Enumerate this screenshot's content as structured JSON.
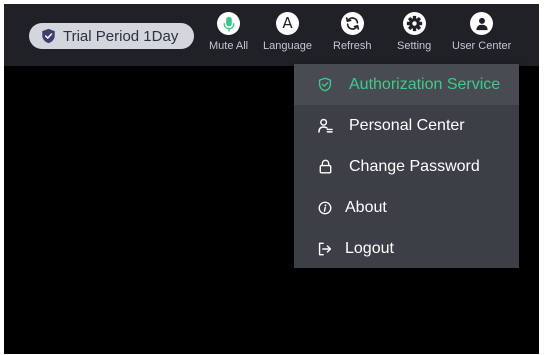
{
  "header": {
    "trial_badge": "Trial Period 1Day",
    "buttons": {
      "mute_all": {
        "label": "Mute All",
        "icon": "microphone-icon"
      },
      "language": {
        "label": "Language",
        "glyph": "A",
        "icon": "language-icon"
      },
      "refresh": {
        "label": "Refresh",
        "icon": "refresh-icon"
      },
      "setting": {
        "label": "Setting",
        "icon": "gear-icon"
      },
      "user_center": {
        "label": "User Center",
        "icon": "user-icon"
      }
    }
  },
  "user_menu": {
    "items": [
      {
        "label": "Authorization Service",
        "icon": "shield-check-icon",
        "active": true
      },
      {
        "label": "Personal Center",
        "icon": "person-card-icon",
        "active": false
      },
      {
        "label": "Change Password",
        "icon": "lock-icon",
        "active": false
      },
      {
        "label": "About",
        "icon": "info-icon",
        "active": false
      },
      {
        "label": "Logout",
        "icon": "logout-icon",
        "active": false
      }
    ]
  },
  "colors": {
    "accent_green": "#3fc98a",
    "topbar_bg": "#1f2127",
    "menu_bg": "#3d3f47",
    "content_bg": "#000000",
    "badge_bg": "#d3d6dc",
    "mic_green": "#38c98a"
  }
}
